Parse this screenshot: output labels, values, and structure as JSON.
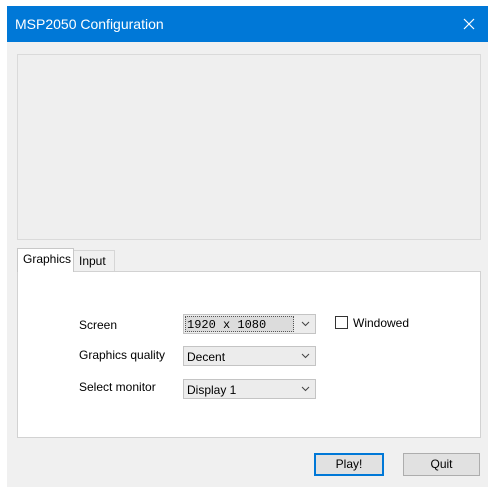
{
  "window": {
    "title": "MSP2050 Configuration",
    "close_icon": "close-icon"
  },
  "tabs": [
    {
      "label": "Graphics",
      "active": true
    },
    {
      "label": "Input",
      "active": false
    }
  ],
  "graphics": {
    "screen": {
      "label": "Screen",
      "value": "1920 x 1080"
    },
    "quality": {
      "label": "Graphics quality",
      "value": "Decent"
    },
    "monitor": {
      "label": "Select monitor",
      "value": "Display 1"
    },
    "windowed": {
      "label": "Windowed",
      "checked": false
    }
  },
  "buttons": {
    "play": "Play!",
    "quit": "Quit"
  },
  "colors": {
    "titlebar": "#0078d7",
    "window_bg": "#f0f0f0",
    "focus_border": "#0078d7"
  }
}
